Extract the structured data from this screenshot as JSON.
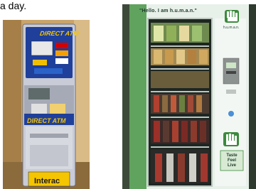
{
  "caption": "a day.",
  "atm": {
    "brand_top": "DIRECT ATM",
    "brand_mid": "DIRECT ATM",
    "network_sign": "Interac"
  },
  "vending": {
    "slogan": "\"Hello. I am h.u.m.a.n.\"",
    "brand": "h.u.m.a.n.",
    "side_sign": "Taste\nFeel\nLive"
  }
}
